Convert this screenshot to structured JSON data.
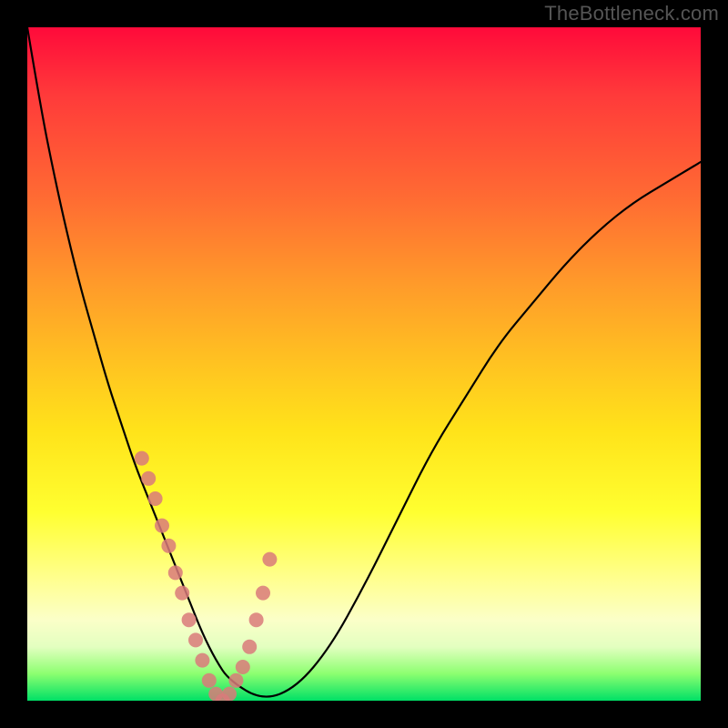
{
  "watermark": "TheBottleneck.com",
  "colors": {
    "curve_stroke": "#000000",
    "marker_fill": "#d97a7a",
    "marker_stroke": "#b85a5a",
    "frame_bg": "#000000"
  },
  "chart_data": {
    "type": "line",
    "title": "",
    "xlabel": "",
    "ylabel": "",
    "xlim": [
      0,
      100
    ],
    "ylim": [
      0,
      100
    ],
    "grid": false,
    "legend": false,
    "series": [
      {
        "name": "bottleneck-curve",
        "x_percent_of_width": [
          0,
          2,
          4,
          6,
          8,
          10,
          12,
          14,
          16,
          18,
          20,
          22,
          24,
          26,
          28,
          30,
          35,
          40,
          45,
          50,
          55,
          60,
          65,
          70,
          75,
          80,
          85,
          90,
          95,
          100
        ],
        "y_percent_from_top": [
          0,
          12,
          22,
          31,
          39,
          46,
          53,
          59,
          65,
          70,
          75,
          80,
          85,
          90,
          94,
          97,
          100,
          98,
          92,
          83,
          73,
          63,
          55,
          47,
          41,
          35,
          30,
          26,
          23,
          20
        ],
        "note": "x and y given as percentage of plot area; y=100 is bottom (lowest bottleneck), y=0 is top"
      }
    ],
    "highlight_markers": {
      "description": "Scatter points near the trough of the curve indicating near-optimal hardware pairings",
      "x_percent_of_width": [
        17,
        18,
        19,
        20,
        21,
        22,
        23,
        24,
        25,
        26,
        27,
        28,
        29,
        30,
        31,
        32,
        33,
        34,
        35,
        36
      ],
      "y_percent_from_top": [
        64,
        67,
        70,
        74,
        77,
        81,
        84,
        88,
        91,
        94,
        97,
        99,
        100,
        99,
        97,
        95,
        92,
        88,
        84,
        79
      ]
    }
  }
}
